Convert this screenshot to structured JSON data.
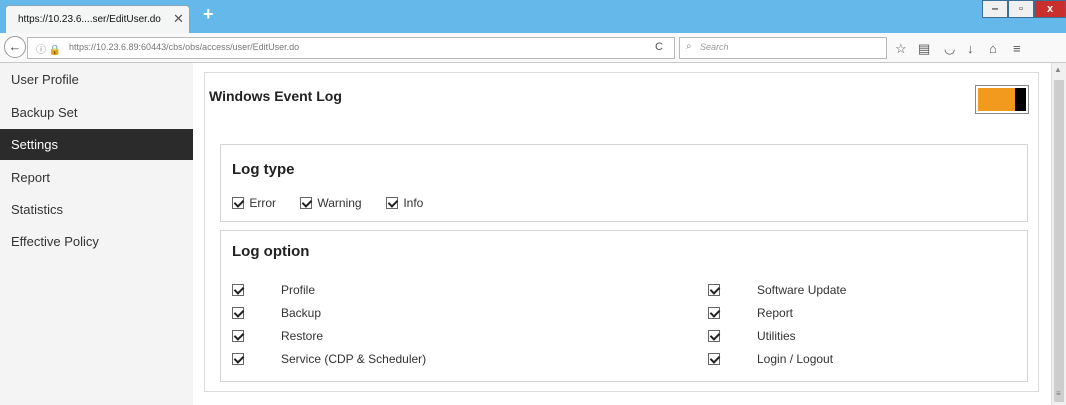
{
  "browser": {
    "tab_title": "https://10.23.6....ser/EditUser.do",
    "tab_close": "✕",
    "new_tab": "+",
    "url": "https://10.23.6.89:60443/cbs/obs/access/user/EditUser.do",
    "search_placeholder": "Search",
    "window_controls": {
      "minimize": "‒",
      "maximize": "▫",
      "close": "x"
    }
  },
  "sidebar": {
    "items": [
      {
        "label": "User Profile",
        "active": false
      },
      {
        "label": "Backup Set",
        "active": false
      },
      {
        "label": "Settings",
        "active": true
      },
      {
        "label": "Report",
        "active": false
      },
      {
        "label": "Statistics",
        "active": false
      },
      {
        "label": "Effective Policy",
        "active": false
      }
    ]
  },
  "main": {
    "title": "Windows Event Log",
    "toggle": {
      "state": "on",
      "color": "#f19a1d"
    },
    "log_type": {
      "heading": "Log type",
      "options": [
        {
          "label": "Error",
          "checked": true
        },
        {
          "label": "Warning",
          "checked": true
        },
        {
          "label": "Info",
          "checked": true
        }
      ]
    },
    "log_option": {
      "heading": "Log option",
      "left": [
        {
          "label": "Profile",
          "checked": true
        },
        {
          "label": "Backup",
          "checked": true
        },
        {
          "label": "Restore",
          "checked": true
        },
        {
          "label": "Service (CDP & Scheduler)",
          "checked": true
        }
      ],
      "right": [
        {
          "label": "Software Update",
          "checked": true
        },
        {
          "label": "Report",
          "checked": true
        },
        {
          "label": "Utilities",
          "checked": true
        },
        {
          "label": "Login / Logout",
          "checked": true
        }
      ]
    }
  }
}
